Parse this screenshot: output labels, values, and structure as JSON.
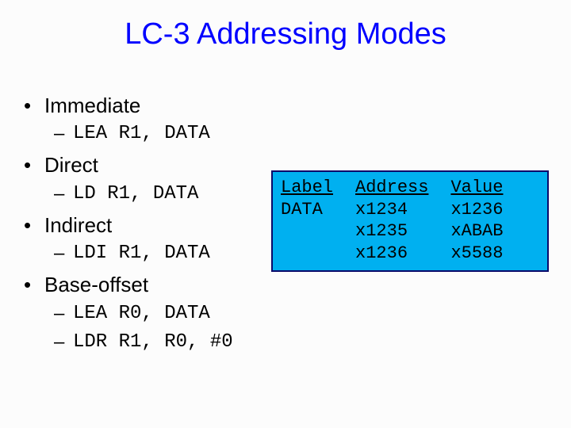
{
  "title": "LC-3 Addressing Modes",
  "modes": {
    "immediate": {
      "name": "Immediate",
      "code1": "LEA R1, DATA"
    },
    "direct": {
      "name": "Direct",
      "code1": "LD R1, DATA"
    },
    "indirect": {
      "name": "Indirect",
      "code1": "LDI R1, DATA"
    },
    "baseoffset": {
      "name": "Base-offset",
      "code1": "LEA R0, DATA",
      "code2": "LDR R1, R0, #0"
    }
  },
  "table": {
    "headers": {
      "label": "Label",
      "address": "Address",
      "value": "Value"
    },
    "labels": [
      "DATA"
    ],
    "addresses": [
      "x1234",
      "x1235",
      "x1236"
    ],
    "values": [
      "x1236",
      "xABAB",
      "x5588"
    ]
  }
}
